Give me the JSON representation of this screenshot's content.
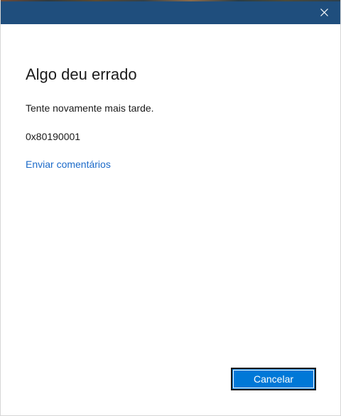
{
  "window": {
    "titlebar_color": "#1f4e7d",
    "close_icon": "close-icon"
  },
  "dialog": {
    "title": "Algo deu errado",
    "message": "Tente novamente mais tarde.",
    "error_code": "0x80190001",
    "feedback_link": "Enviar comentários"
  },
  "footer": {
    "cancel_label": "Cancelar"
  },
  "colors": {
    "accent": "#0078d7",
    "link": "#1b6ac9",
    "text": "#1b1b1b"
  }
}
